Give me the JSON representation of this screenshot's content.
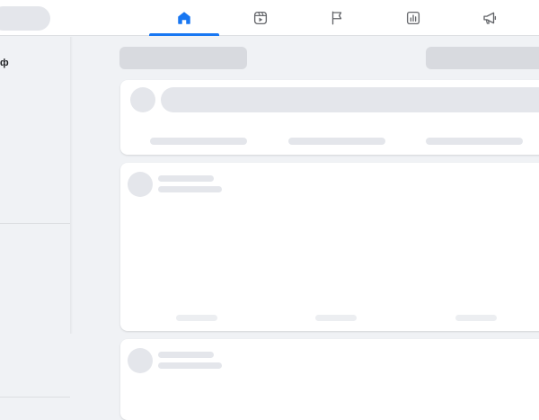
{
  "topbar": {
    "tabs": [
      {
        "name": "home",
        "icon": "home-icon",
        "active": true
      },
      {
        "name": "reels",
        "icon": "reels-icon",
        "active": false
      },
      {
        "name": "pages",
        "icon": "flag-icon",
        "active": false
      },
      {
        "name": "insights",
        "icon": "chart-icon",
        "active": false
      },
      {
        "name": "ads",
        "icon": "megaphone-icon",
        "active": false
      }
    ]
  },
  "sidebar": {
    "partial_label": "ф"
  },
  "colors": {
    "accent": "#1877f2",
    "skeleton": "#e4e6eb",
    "background": "#f0f2f5",
    "icon": "#65676b"
  }
}
